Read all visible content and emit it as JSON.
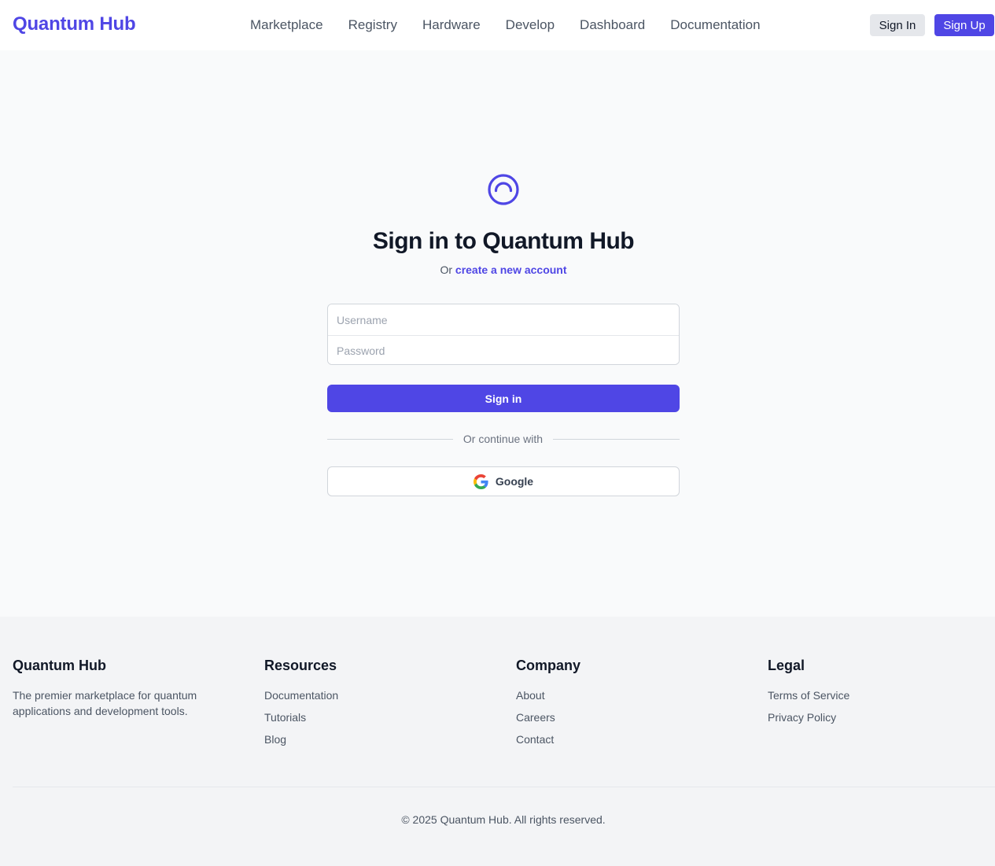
{
  "header": {
    "brand": "Quantum Hub",
    "nav": [
      "Marketplace",
      "Registry",
      "Hardware",
      "Develop",
      "Dashboard",
      "Documentation"
    ],
    "sign_in": "Sign In",
    "sign_up": "Sign Up"
  },
  "login": {
    "logo_icon": "quantum-circle-icon",
    "title": "Sign in to Quantum Hub",
    "subtitle_prefix": "Or",
    "create_link": "create a new account",
    "username_placeholder": "Username",
    "password_placeholder": "Password",
    "submit_label": "Sign in",
    "divider_text": "Or continue with",
    "google_label": "Google",
    "google_icon": "google-icon"
  },
  "footer": {
    "about": {
      "title": "Quantum Hub",
      "description": "The premier marketplace for quantum applications and development tools."
    },
    "resources": {
      "title": "Resources",
      "links": [
        "Documentation",
        "Tutorials",
        "Blog"
      ]
    },
    "company": {
      "title": "Company",
      "links": [
        "About",
        "Careers",
        "Contact"
      ]
    },
    "legal": {
      "title": "Legal",
      "links": [
        "Terms of Service",
        "Privacy Policy"
      ]
    },
    "copyright": "© 2025 Quantum Hub. All rights reserved."
  },
  "colors": {
    "accent": "#4f46e5",
    "page_bg": "#f9fafb",
    "footer_bg": "#f3f4f6"
  }
}
